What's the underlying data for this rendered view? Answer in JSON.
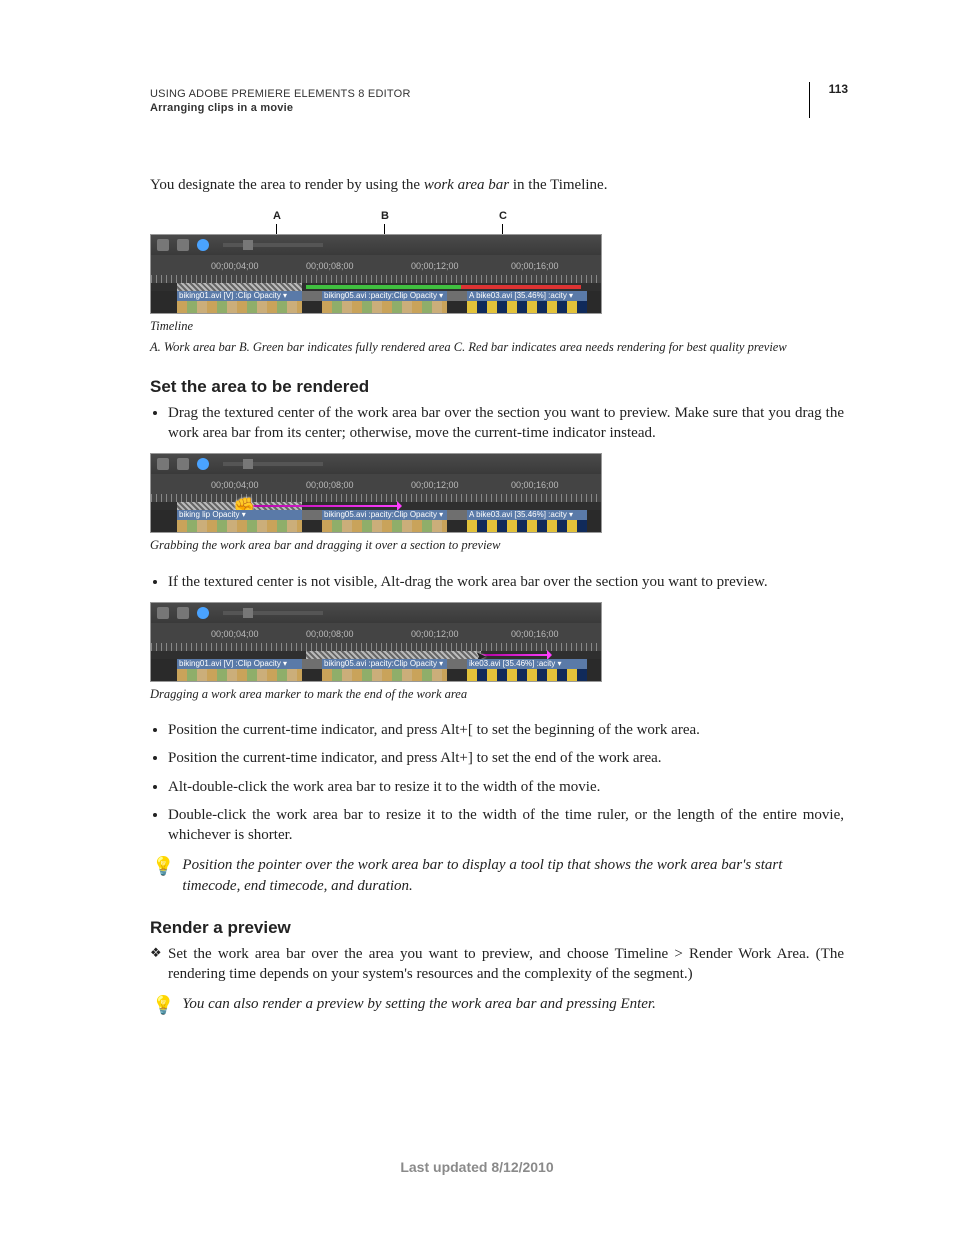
{
  "header": {
    "line1": "USING ADOBE PREMIERE ELEMENTS 8 EDITOR",
    "line2": "Arranging clips in a movie",
    "page_number": "113"
  },
  "intro": {
    "pre": "You designate the area to render by using the ",
    "work_area_bar": "work area bar",
    "post": " in the Timeline."
  },
  "fig1": {
    "labels": {
      "a": "A",
      "b": "B",
      "c": "C"
    },
    "timecodes": [
      "00;00;04;00",
      "00;00;08;00",
      "00;00;12;00",
      "00;00;16;00"
    ],
    "clips": {
      "c1": "biking01.avi [V] :Clip Opacity ▾",
      "c2": "biking05.avi :pacity:Clip Opacity ▾",
      "c3": "A bike03.avi [35.46%] :acity ▾"
    },
    "caption_title": "Timeline",
    "caption": "A. Work area bar  B. Green bar indicates fully rendered area  C. Red bar indicates area needs rendering for best quality preview"
  },
  "h_set_area": "Set the area to be rendered",
  "set_area_bullets": {
    "b1": "Drag the textured center of the work area bar over the section you want to preview. Make sure that you drag the work area bar from its center; otherwise, move the current-time indicator instead.",
    "b2": "If the textured center is not visible, Alt-drag the work area bar over the section you want to preview.",
    "b3": "Position the current-time indicator, and press Alt+[ to set the beginning of the work area.",
    "b4": "Position the current-time indicator, and press Alt+] to set the end of the work area.",
    "b5": "Alt-double-click the work area bar to resize it to the width of the movie.",
    "b6": "Double-click the work area bar to resize it to the width of the time ruler, or the length of the entire movie, whichever is shorter."
  },
  "fig2": {
    "timecodes": [
      "00;00;04;00",
      "00;00;08;00",
      "00;00;12;00",
      "00;00;16;00"
    ],
    "clips": {
      "c1": "biking  lip Opacity ▾",
      "c2": "biking05.avi :pacity:Clip Opacity ▾",
      "c3": "A bike03.avi [35.46%] :acity ▾"
    },
    "caption": "Grabbing the work area bar and dragging it over a section to preview"
  },
  "fig3": {
    "timecodes": [
      "00;00;04;00",
      "00;00;08;00",
      "00;00;12;00",
      "00;00;16;00"
    ],
    "clips": {
      "c1": "biking01.avi [V] :Clip Opacity ▾",
      "c2": "biking05.avi :pacity:Clip Opacity ▾",
      "c3": "ike03.avi [35.46%] :acity ▾"
    },
    "caption": "Dragging a work area marker to mark the end of the work area"
  },
  "tip1": "Position the pointer over the work area bar to display a tool tip that shows the work area bar's start timecode, end timecode, and duration.",
  "h_render": "Render a preview",
  "render_bullet": "Set the work area bar over the area you want to preview, and choose Timeline > Render Work Area. (The rendering time depends on your system's resources and the complexity of the segment.)",
  "tip2": "You can also render a preview by setting the work area bar and pressing Enter.",
  "footer": "Last updated 8/12/2010"
}
